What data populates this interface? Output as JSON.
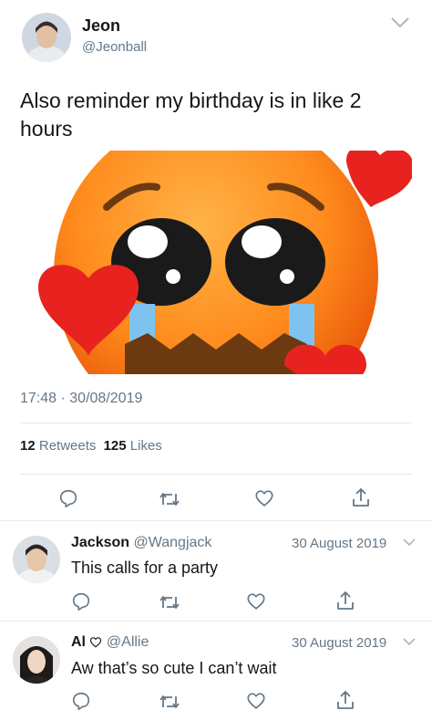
{
  "tweet": {
    "author": {
      "name": "Jeon",
      "handle": "@Jeonball"
    },
    "text_line1": "Also reminder my birthday is in like 2",
    "text_line2": "hours",
    "time": "17:48",
    "dot": "·",
    "date": "30/08/2019",
    "retweets_count": "12",
    "retweets_label": "Retweets",
    "likes_count": "125",
    "likes_label": "Likes"
  },
  "replies": [
    {
      "name": "Jackson",
      "handle": "@Wangjack",
      "date": "30 August 2019",
      "text": "This calls for a party"
    },
    {
      "name": "Al",
      "handle": "@Allie",
      "date": "30 August 2019",
      "text": "Aw that’s so cute I can’t wait"
    }
  ],
  "icons": [
    "chevron-down-icon",
    "reply-icon",
    "retweet-icon",
    "heart-icon",
    "share-icon"
  ],
  "colors": {
    "text": "#14171a",
    "secondary": "#657786",
    "divider": "#e1e8ed"
  }
}
